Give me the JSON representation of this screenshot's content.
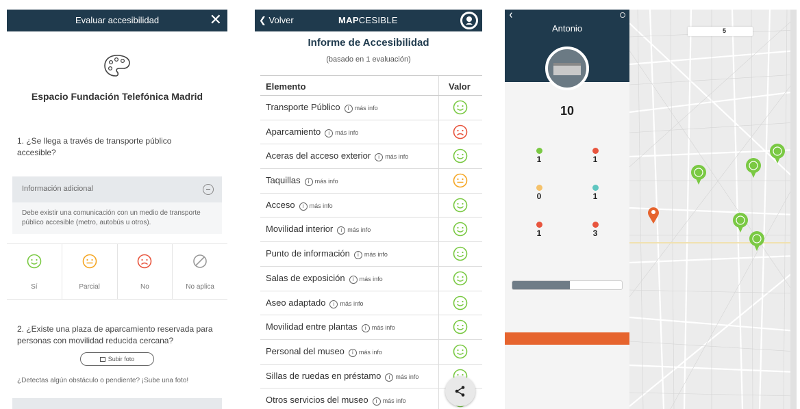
{
  "screen1": {
    "header_title": "Evaluar accesibilidad",
    "close_symbol": "✕",
    "place_name": "Espacio Fundación Telefónica Madrid",
    "question1": "1. ¿Se llega a través de transporte público accesible?",
    "info_label": "Información adicional",
    "info_text": "Debe existir una comunicación con un medio de transporte público accesible (metro, autobús u otros).",
    "options": [
      {
        "label": "Sí",
        "icon": "happy-face-icon",
        "color": "#7ac943"
      },
      {
        "label": "Parcial",
        "icon": "neutral-face-icon",
        "color": "#f5a623"
      },
      {
        "label": "No",
        "icon": "sad-face-icon",
        "color": "#e8553e"
      },
      {
        "label": "No aplica",
        "icon": "not-applicable-icon",
        "color": "#999999"
      }
    ],
    "question2": "2. ¿Existe una plaza de aparcamiento reservada para personas con movilidad reducida cercana?",
    "upload_label": "Subir foto",
    "detect_text": "¿Detectas algún obstáculo o pendiente? ¡Sube una foto!"
  },
  "screen2": {
    "back_label": "Volver",
    "brand_bold": "MAP",
    "brand_light": "CESIBLE",
    "report_title": "Informe de Accesibilidad",
    "report_subtitle": "(basado en 1 evaluación)",
    "col_element": "Elemento",
    "col_value": "Valor",
    "more_info": "más info",
    "rows": [
      {
        "label": "Transporte Público",
        "rating": "good"
      },
      {
        "label": "Aparcamiento",
        "rating": "bad"
      },
      {
        "label": "Aceras del acceso exterior",
        "rating": "good"
      },
      {
        "label": "Taquillas",
        "rating": "partial"
      },
      {
        "label": "Acceso",
        "rating": "good"
      },
      {
        "label": "Movilidad interior",
        "rating": "good"
      },
      {
        "label": "Punto de información",
        "rating": "good"
      },
      {
        "label": "Salas de exposición",
        "rating": "good"
      },
      {
        "label": "Aseo adaptado",
        "rating": "good"
      },
      {
        "label": "Movilidad entre plantas",
        "rating": "good"
      },
      {
        "label": "Personal del museo",
        "rating": "good"
      },
      {
        "label": "Sillas de ruedas en préstamo",
        "rating": "good"
      },
      {
        "label": "Otros servicios del museo",
        "rating": "good"
      }
    ],
    "colors": {
      "good": "#7ac943",
      "partial": "#f5a623",
      "bad": "#e8553e"
    }
  },
  "screen3": {
    "user_name": "Antonio",
    "level_value": "10",
    "stats": [
      {
        "value": "1",
        "color": "#7ac943"
      },
      {
        "value": "1",
        "color": "#e8553e"
      },
      {
        "value": "0",
        "color": "#f5c26b"
      },
      {
        "value": "1",
        "color": "#5fc6c0"
      },
      {
        "value": "1",
        "color": "#e8553e"
      },
      {
        "value": "3",
        "color": "#e8553e"
      }
    ],
    "map_count": "5",
    "colors": {
      "header": "#1f3a4d",
      "action": "#e6642e",
      "pin_green": "#7ac943",
      "pin_orange": "#e6642e"
    }
  }
}
